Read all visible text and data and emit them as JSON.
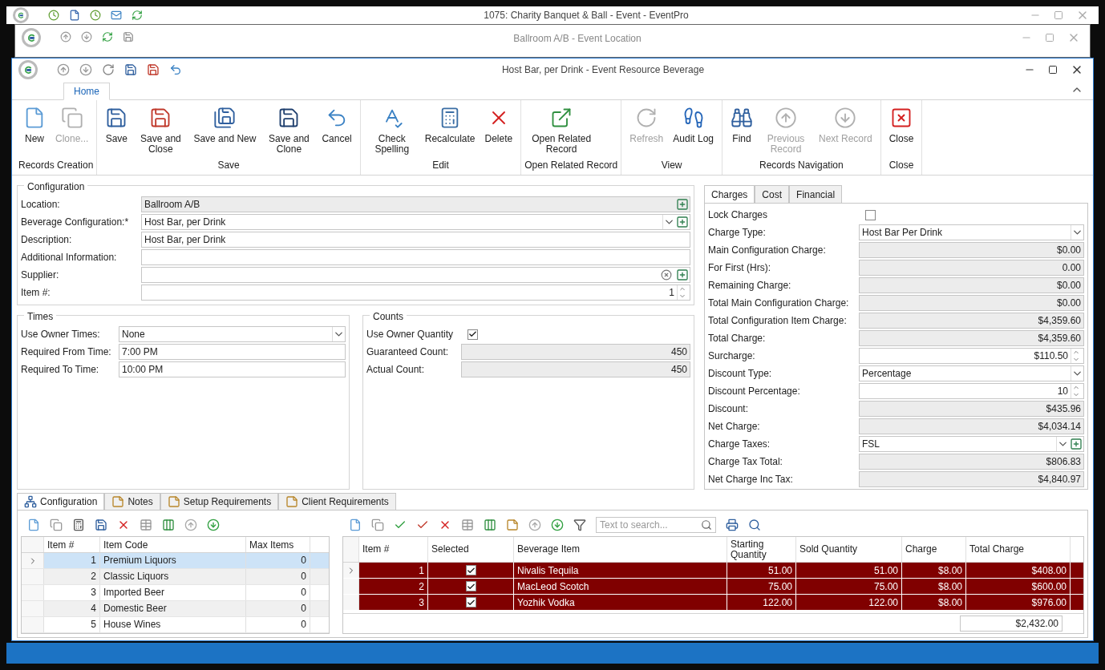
{
  "background_windows": [
    {
      "title": "1075: Charity Banquet & Ball - Event - EventPro"
    },
    {
      "title": "Ballroom A/B - Event Location"
    }
  ],
  "window": {
    "title": "Host Bar, per Drink - Event Resource Beverage"
  },
  "ribbon_tabs": [
    {
      "label": "Home",
      "selected": true
    }
  ],
  "ribbon_groups": [
    {
      "label": "Records Creation",
      "buttons": [
        {
          "label": "New",
          "disabled": false
        },
        {
          "label": "Clone...",
          "disabled": true
        }
      ]
    },
    {
      "label": "Save",
      "buttons": [
        {
          "label": "Save",
          "disabled": false
        },
        {
          "label": "Save and Close",
          "disabled": false
        },
        {
          "label": "Save and New",
          "disabled": false
        },
        {
          "label": "Save and Clone",
          "disabled": false
        },
        {
          "label": "Cancel",
          "disabled": false
        }
      ]
    },
    {
      "label": "Edit",
      "buttons": [
        {
          "label": "Check Spelling",
          "disabled": false
        },
        {
          "label": "Recalculate",
          "disabled": false
        },
        {
          "label": "Delete",
          "disabled": false
        }
      ]
    },
    {
      "label": "Open Related Record",
      "buttons": [
        {
          "label": "Open Related Record",
          "disabled": false
        }
      ]
    },
    {
      "label": "View",
      "buttons": [
        {
          "label": "Refresh",
          "disabled": true
        },
        {
          "label": "Audit Log",
          "disabled": false
        }
      ]
    },
    {
      "label": "Records Navigation",
      "buttons": [
        {
          "label": "Find",
          "disabled": false
        },
        {
          "label": "Previous Record",
          "disabled": true
        },
        {
          "label": "Next Record",
          "disabled": true
        }
      ]
    },
    {
      "label": "Close",
      "buttons": [
        {
          "label": "Close",
          "disabled": false
        }
      ]
    }
  ],
  "configuration": {
    "title": "Configuration",
    "fields": [
      {
        "label": "Location:",
        "kind": "text",
        "value": "Ballroom A/B",
        "readonly": true,
        "lookup": true
      },
      {
        "label": "Beverage Configuration:*",
        "kind": "dropdown",
        "value": "Host Bar, per Drink",
        "lookup": true
      },
      {
        "label": "Description:",
        "kind": "text",
        "value": "Host Bar, per Drink"
      },
      {
        "label": "Additional Information:",
        "kind": "text"
      },
      {
        "label": "Supplier:",
        "kind": "text",
        "clearable": true,
        "lookup": true
      },
      {
        "label": "Item #:",
        "kind": "spinner",
        "value": "1"
      }
    ]
  },
  "times": {
    "title": "Times",
    "fields": [
      {
        "label": "Use Owner Times:",
        "kind": "dropdown",
        "value": "None"
      },
      {
        "label": "Required From Time:",
        "kind": "text",
        "value": "7:00 PM"
      },
      {
        "label": "Required To Time:",
        "kind": "text",
        "value": "10:00 PM"
      }
    ]
  },
  "counts": {
    "title": "Counts",
    "fields": [
      {
        "label": "Use Owner Quantity",
        "kind": "checkbox",
        "checked": true
      },
      {
        "label": "Guaranteed Count:",
        "kind": "amount",
        "value": "450",
        "readonly": true
      },
      {
        "label": "Actual Count:",
        "kind": "amount",
        "value": "450",
        "readonly": true
      }
    ]
  },
  "charge_tabs": [
    {
      "label": "Charges",
      "selected": true
    },
    {
      "label": "Cost",
      "selected": false
    },
    {
      "label": "Financial",
      "selected": false
    }
  ],
  "charges": [
    {
      "label": "Lock Charges",
      "kind": "checkbox",
      "checked": false
    },
    {
      "label": "Charge Type:",
      "kind": "dropdown",
      "value": "Host Bar Per Drink"
    },
    {
      "label": "Main Configuration Charge:",
      "kind": "amount",
      "value": "$0.00",
      "readonly": true
    },
    {
      "label": "For First (Hrs):",
      "kind": "amount",
      "value": "0.00",
      "readonly": true
    },
    {
      "label": "Remaining Charge:",
      "kind": "amount",
      "value": "$0.00",
      "readonly": true
    },
    {
      "label": "Total Main Configuration Charge:",
      "kind": "amount",
      "value": "$0.00",
      "readonly": true
    },
    {
      "label": "Total Configuration Item Charge:",
      "kind": "amount",
      "value": "$4,359.60",
      "readonly": true
    },
    {
      "label": "Total Charge:",
      "kind": "amount",
      "value": "$4,359.60",
      "readonly": true
    },
    {
      "label": "Surcharge:",
      "kind": "spinner",
      "value": "$110.50"
    },
    {
      "label": "Discount Type:",
      "kind": "dropdown",
      "value": "Percentage"
    },
    {
      "label": "Discount Percentage:",
      "kind": "spinner",
      "value": "10"
    },
    {
      "label": "Discount:",
      "kind": "amount",
      "value": "$435.96",
      "readonly": true
    },
    {
      "label": "Net Charge:",
      "kind": "amount",
      "value": "$4,034.14",
      "readonly": true
    },
    {
      "label": "Charge Taxes:",
      "kind": "dropdown",
      "value": "FSL",
      "lookup": true
    },
    {
      "label": "Charge Tax Total:",
      "kind": "amount",
      "value": "$806.83",
      "readonly": true
    },
    {
      "label": "Net Charge Inc Tax:",
      "kind": "amount",
      "value": "$4,840.97",
      "readonly": true
    }
  ],
  "bottom_tabs": [
    {
      "label": "Configuration",
      "selected": true
    },
    {
      "label": "Notes",
      "selected": false
    },
    {
      "label": "Setup Requirements",
      "selected": false
    },
    {
      "label": "Client Requirements",
      "selected": false
    }
  ],
  "items_grid": {
    "columns": [
      "Item #",
      "Item Code",
      "Max Items"
    ],
    "rows": [
      {
        "cells": [
          "1",
          "Premium Liquors",
          "0"
        ],
        "selected": true
      },
      {
        "cells": [
          "2",
          "Classic Liquors",
          "0"
        ],
        "selected": false
      },
      {
        "cells": [
          "3",
          "Imported Beer",
          "0"
        ],
        "selected": false
      },
      {
        "cells": [
          "4",
          "Domestic Beer",
          "0"
        ],
        "selected": false
      },
      {
        "cells": [
          "5",
          "House Wines",
          "0"
        ],
        "selected": false
      }
    ]
  },
  "beverage_grid": {
    "search": {
      "placeholder": "Text to search..."
    },
    "columns": [
      "Item #",
      "Selected",
      "Beverage Item",
      "Starting Quantity",
      "Sold Quantity",
      "Charge",
      "Total Charge"
    ],
    "rows": [
      {
        "item": "1",
        "checked": true,
        "name": "Nivalis Tequila",
        "starting": "51.00",
        "sold": "51.00",
        "charge": "$8.00",
        "total": "$408.00",
        "selected": true
      },
      {
        "item": "2",
        "checked": true,
        "name": "MacLeod Scotch",
        "starting": "75.00",
        "sold": "75.00",
        "charge": "$8.00",
        "total": "$600.00",
        "selected": true
      },
      {
        "item": "3",
        "checked": true,
        "name": "Yozhik Vodka",
        "starting": "122.00",
        "sold": "122.00",
        "charge": "$8.00",
        "total": "$976.00",
        "selected": true
      }
    ],
    "footer_total": "$2,432.00"
  }
}
